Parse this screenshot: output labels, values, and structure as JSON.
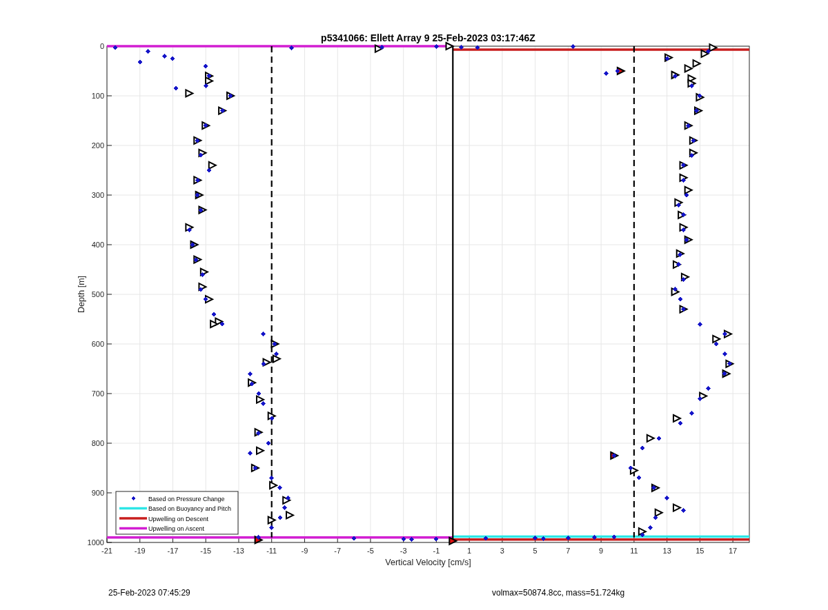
{
  "figure": {
    "chart_data": {
      "type": "scatter",
      "title": "p5341066: Ellett Array 9 25-Feb-2023 03:17:46Z",
      "xlabel": "Vertical Velocity [cm/s]",
      "ylabel": "Depth [m]",
      "xlim": [
        -21,
        18
      ],
      "ylim": [
        1000,
        0
      ],
      "xticks": [
        -21,
        -19,
        -17,
        -15,
        -13,
        -11,
        -9,
        -7,
        -5,
        -3,
        -1,
        1,
        3,
        5,
        7,
        9,
        11,
        13,
        15,
        17
      ],
      "yticks": [
        0,
        100,
        200,
        300,
        400,
        500,
        600,
        700,
        800,
        900,
        1000
      ],
      "grid": true,
      "legend": true,
      "ref_lines": [
        {
          "axis": "x",
          "value": -11,
          "color": "#000000"
        },
        {
          "axis": "x",
          "value": 11,
          "color": "#000000"
        }
      ],
      "series": [
        {
          "name": "Upwelling on Ascent",
          "color": "#d21ed2",
          "type": "line",
          "x": [
            -21,
            0
          ],
          "values": [
            0,
            0
          ]
        },
        {
          "color": "#d21ed2",
          "type": "line",
          "x": [
            -21,
            0
          ],
          "values": [
            990,
            990
          ]
        },
        {
          "name": "Upwelling on Descent",
          "color": "#c81e1e",
          "type": "line",
          "x": [
            0,
            18
          ],
          "values": [
            7,
            7
          ]
        },
        {
          "color": "#c81e1e",
          "type": "line",
          "x": [
            0,
            18
          ],
          "values": [
            994,
            994
          ]
        },
        {
          "name": "Based on Buoyancy and Pitch",
          "color": "#2de6e6",
          "type": "line",
          "x": [
            0,
            18
          ],
          "values": [
            988,
            988
          ]
        },
        {
          "color": "#000000",
          "type": "line",
          "x": [
            0,
            0
          ],
          "values": [
            0,
            1000
          ]
        },
        {
          "name": "Based on Pressure Change",
          "color": "#1515c8",
          "type": "scatter",
          "marker": "diamond",
          "x": [
            -20.5,
            -18.5,
            -17.5,
            -19,
            -17,
            -16.8,
            -15,
            -14.8,
            -15,
            -13.5,
            -14,
            -15,
            -15.5,
            -15.3,
            -14.8,
            -15.5,
            -15.5,
            -15.3,
            -16,
            -15.8,
            -15.6,
            -15.2,
            -15.3,
            -15,
            -14.5,
            -14,
            -11.5,
            -10.8,
            -10.7,
            -11.5,
            -12.3,
            -12.2,
            -11.8,
            -11.5,
            -11,
            -11.8,
            -11.2,
            -12.3,
            -12,
            -11,
            -10.5,
            -10,
            -10.2,
            -10.5,
            -11,
            -11.8,
            -9.8,
            -4.3,
            -1,
            0.5,
            1.5,
            7.3,
            15.5,
            13,
            10,
            9.3,
            13.5,
            14.5,
            15,
            14.8,
            14.3,
            14.6,
            14.5,
            14,
            14,
            14.2,
            13.7,
            14,
            14,
            14.2,
            13.8,
            13.7,
            14,
            13.5,
            13.8,
            14,
            15,
            16.5,
            16,
            16.5,
            16.8,
            16.5,
            15.5,
            15,
            14.5,
            13.8,
            12.5,
            11.5,
            9.8,
            10.8,
            11.3,
            12.2,
            13,
            14,
            12.3,
            12,
            11.5,
            -6,
            -3,
            -2.5,
            -1,
            2,
            5,
            5.5,
            7,
            8.6,
            9.8
          ],
          "values": [
            3,
            10,
            20,
            32,
            25,
            85,
            40,
            60,
            80,
            100,
            130,
            160,
            190,
            220,
            250,
            270,
            300,
            330,
            370,
            400,
            430,
            460,
            490,
            510,
            540,
            560,
            580,
            600,
            620,
            640,
            660,
            680,
            700,
            720,
            750,
            780,
            800,
            820,
            850,
            870,
            890,
            910,
            930,
            950,
            970,
            990,
            3,
            2,
            1,
            2,
            3,
            1,
            10,
            25,
            50,
            55,
            60,
            80,
            100,
            130,
            160,
            190,
            220,
            240,
            270,
            300,
            320,
            340,
            370,
            390,
            420,
            440,
            470,
            490,
            510,
            530,
            560,
            580,
            600,
            620,
            640,
            660,
            690,
            710,
            740,
            760,
            790,
            810,
            825,
            850,
            870,
            890,
            910,
            935,
            950,
            970,
            985,
            992,
            993,
            994,
            993,
            992,
            991,
            992,
            991,
            990,
            989
          ]
        },
        {
          "color": "#ffffff",
          "type": "scatter",
          "marker": "triangle",
          "x": [
            -4.5,
            -14.8,
            -14.8,
            -16,
            -13.5,
            -14,
            -15,
            -15.5,
            -15.2,
            -14.6,
            -15.5,
            -15.4,
            -15.2,
            -16,
            -15.7,
            -15.5,
            -15.1,
            -15.2,
            -14.8,
            -14.2,
            -14.5,
            -10.8,
            -10.7,
            -11.3,
            -12.2,
            -11.7,
            -11,
            -11.8,
            -11.7,
            -12,
            -10.9,
            -10.1,
            -9.9,
            -11,
            -0.2,
            15.8,
            15.3,
            13.1,
            14.8,
            14.3,
            13.5,
            14.5,
            14.5,
            15,
            14.9,
            14.3,
            14.6,
            14.6,
            14,
            14,
            14.3,
            13.7,
            13.9,
            14,
            14.3,
            13.8,
            13.6,
            14.1,
            13.5,
            14,
            16.7,
            16,
            16.8,
            16.6,
            15.2,
            13.6,
            12,
            11,
            12.3,
            13.6,
            12.5,
            11.5
          ],
          "values": [
            5,
            60,
            70,
            95,
            100,
            130,
            160,
            190,
            215,
            240,
            270,
            300,
            330,
            365,
            400,
            430,
            455,
            485,
            510,
            555,
            560,
            600,
            630,
            637,
            678,
            712,
            745,
            778,
            815,
            850,
            885,
            915,
            945,
            955,
            0,
            3,
            15,
            23,
            35,
            45,
            58,
            65,
            75,
            103,
            130,
            160,
            190,
            215,
            240,
            265,
            290,
            315,
            340,
            365,
            390,
            418,
            440,
            465,
            495,
            530,
            580,
            590,
            640,
            660,
            705,
            750,
            790,
            855,
            890,
            930,
            940,
            978
          ]
        },
        {
          "color": "#e01010",
          "type": "scatter",
          "marker": "triangle",
          "x": [
            10.2,
            9.8,
            -11.8,
            0
          ],
          "values": [
            50,
            825,
            995,
            997
          ]
        }
      ]
    }
  },
  "footer": {
    "timestamp": "25-Feb-2023 07:45:29",
    "summary": "volmax=50874.8cc, mass=51.724kg"
  }
}
